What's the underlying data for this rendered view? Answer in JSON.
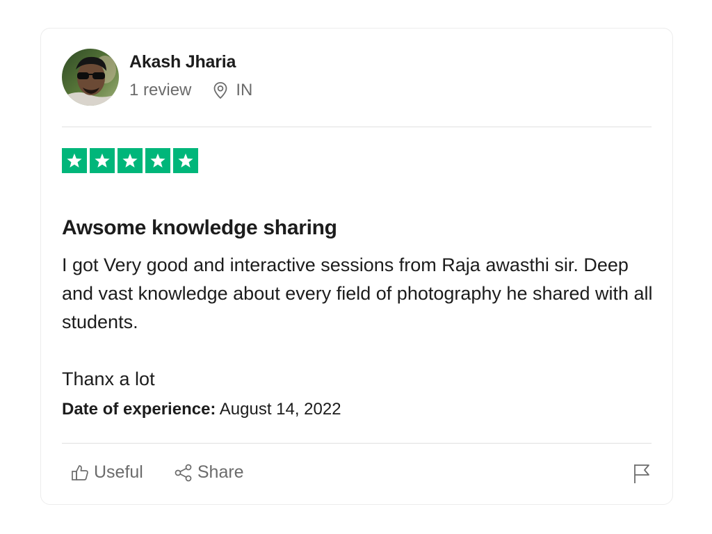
{
  "reviewer": {
    "name": "Akash Jharia",
    "review_count": "1 review",
    "location": "IN",
    "avatar_icon": "user-photo"
  },
  "rating": {
    "stars": 5,
    "max": 5,
    "color": "#00b67a"
  },
  "review": {
    "title": "Awsome knowledge sharing",
    "body_paragraph_1": "I got Very good and interactive sessions from Raja awasthi sir. Deep and vast knowledge about every field of photography he shared with all students.",
    "body_paragraph_2": "Thanx a lot",
    "experience_label": "Date of experience:",
    "experience_date": "August 14, 2022"
  },
  "actions": {
    "useful_label": "Useful",
    "useful_icon": "thumbs-up-icon",
    "share_label": "Share",
    "share_icon": "share-icon",
    "report_icon": "flag-icon"
  }
}
